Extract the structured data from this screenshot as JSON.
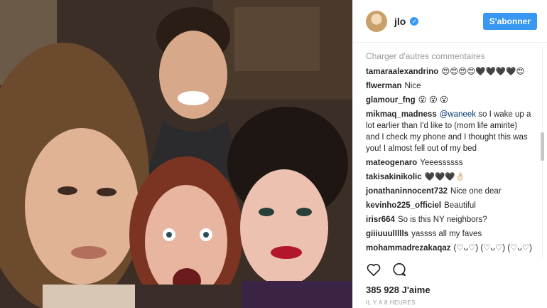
{
  "header": {
    "username": "jlo",
    "follow_label": "S'abonner"
  },
  "load_more": "Charger d'autres commentaires",
  "comments": [
    {
      "user": "tamaraalexandrino",
      "text": "😍😍😍😍🖤🖤🖤🖤😍"
    },
    {
      "user": "flwerman",
      "text": "Nice"
    },
    {
      "user": "glamour_fng",
      "text": "😮 😮 😮"
    },
    {
      "user": "mikmaq_madness",
      "mention": "@waneek",
      "text": "so I wake up a lot earlier than I'd like to (mom life amirite) and I check my phone and I thought this was you! I almost fell out of my bed"
    },
    {
      "user": "mateogenaro",
      "text": "Yeeessssss"
    },
    {
      "user": "takisakinikolic",
      "text": "🖤🖤🖤👌🏻"
    },
    {
      "user": "jonathaninnocent732",
      "text": "Nice one dear"
    },
    {
      "user": "kevinho225_officiel",
      "text": "Beautiful"
    },
    {
      "user": "irisr664",
      "text": "So is this NY neighbors?"
    },
    {
      "user": "giiiuuullllls",
      "text": "yassss all my faves"
    },
    {
      "user": "mohammadrezakaqaz",
      "text": "(♡ᴗ♡) (♡ᴗ♡) (♡ᴗ♡)"
    }
  ],
  "likes": "385 928 J'aime",
  "timestamp": "IL Y A 8 HEURES",
  "colors": {
    "accent": "#3897f0",
    "text": "#262626",
    "muted": "#999999"
  },
  "icons": [
    "verified-badge-icon",
    "heart-icon",
    "comment-icon"
  ]
}
